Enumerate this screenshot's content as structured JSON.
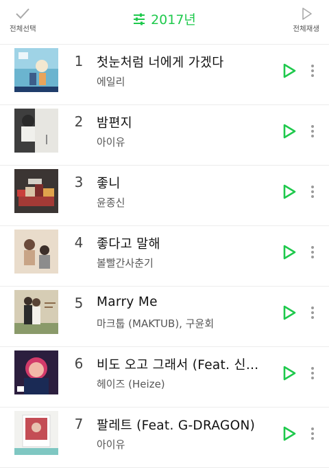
{
  "header": {
    "select_all_label": "전체선택",
    "year": "2017년",
    "play_all_label": "전체재생"
  },
  "colors": {
    "accent": "#1ec94c"
  },
  "icons": {
    "select_all": "check-icon",
    "filter": "sliders-icon",
    "play_all": "play-outline-icon",
    "play": "play-outline-icon",
    "more": "vertical-dots-icon"
  },
  "songs": [
    {
      "rank": "1",
      "title": "첫눈처럼 너에게 가겠다",
      "artist": "에일리"
    },
    {
      "rank": "2",
      "title": "밤편지",
      "artist": "아이유"
    },
    {
      "rank": "3",
      "title": "좋니",
      "artist": "윤종신"
    },
    {
      "rank": "4",
      "title": "좋다고 말해",
      "artist": "볼빨간사춘기"
    },
    {
      "rank": "5",
      "title": "Marry Me",
      "artist": "마크툽 (MAKTUB), 구윤회"
    },
    {
      "rank": "6",
      "title": "비도 오고 그래서 (Feat. 신용재)",
      "artist": "헤이즈 (Heize)"
    },
    {
      "rank": "7",
      "title": "팔레트 (Feat. G-DRAGON)",
      "artist": "아이유"
    }
  ]
}
